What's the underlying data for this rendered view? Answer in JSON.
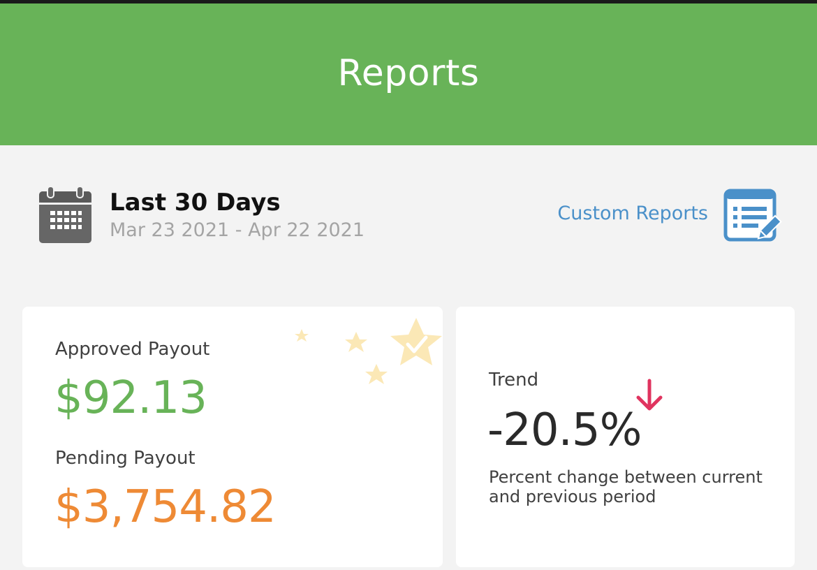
{
  "header": {
    "title": "Reports"
  },
  "range": {
    "title": "Last 30 Days",
    "dates": "Mar 23 2021 - Apr 22 2021",
    "calendar_icon": "calendar-icon"
  },
  "custom_reports": {
    "label": "Custom Reports",
    "icon": "report-edit-icon"
  },
  "payout": {
    "approved_label": "Approved Payout",
    "approved_value": "$92.13",
    "pending_label": "Pending Payout",
    "pending_value": "$3,754.82",
    "decoration_icon": "stars-check-icon"
  },
  "trend": {
    "label": "Trend",
    "value": "-20.5%",
    "direction_icon": "arrow-down-icon",
    "description": "Percent change between current and previous period"
  },
  "colors": {
    "header": "#68b358",
    "approved": "#68b358",
    "pending": "#ee8a35",
    "link": "#4a90c9",
    "trend_arrow": "#e0345f",
    "stars": "#fbe8b6"
  }
}
